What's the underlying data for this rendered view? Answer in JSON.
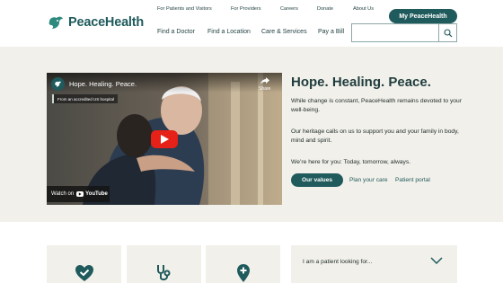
{
  "brand": {
    "name": "PeaceHealth"
  },
  "utility_nav": {
    "items": [
      "For Patients and Visitors",
      "For Providers",
      "Careers",
      "Donate",
      "About Us"
    ],
    "cta": "My PeaceHealth"
  },
  "main_nav": {
    "items": [
      "Find a Doctor",
      "Find a Location",
      "Care & Services",
      "Pay a Bill"
    ],
    "search_placeholder": ""
  },
  "video": {
    "title": "Hope. Healing. Peace.",
    "share_label": "Share",
    "badge": "From an accredited US hospital",
    "watch_on": "Watch on",
    "youtube": "YouTube"
  },
  "hero": {
    "heading": "Hope. Healing. Peace.",
    "paragraphs": [
      "While change is constant, PeaceHealth remains devoted to your well-being.",
      "Our heritage calls on us to support you and your family in body, mind and spirit.",
      "We’re here for you: Today, tomorrow, always."
    ],
    "primary_button": "Our values",
    "links": [
      "Plan your care",
      "Patient portal"
    ]
  },
  "quick_cards": [
    {
      "icon": "heart-check-icon"
    },
    {
      "icon": "stethoscope-icon"
    },
    {
      "icon": "location-pin-plus-icon"
    }
  ],
  "patient_selector": {
    "label": "I am a patient looking for..."
  },
  "colors": {
    "brand": "#1f5a5c",
    "hero_bg": "#f2f0ea",
    "youtube_red": "#e62117"
  }
}
